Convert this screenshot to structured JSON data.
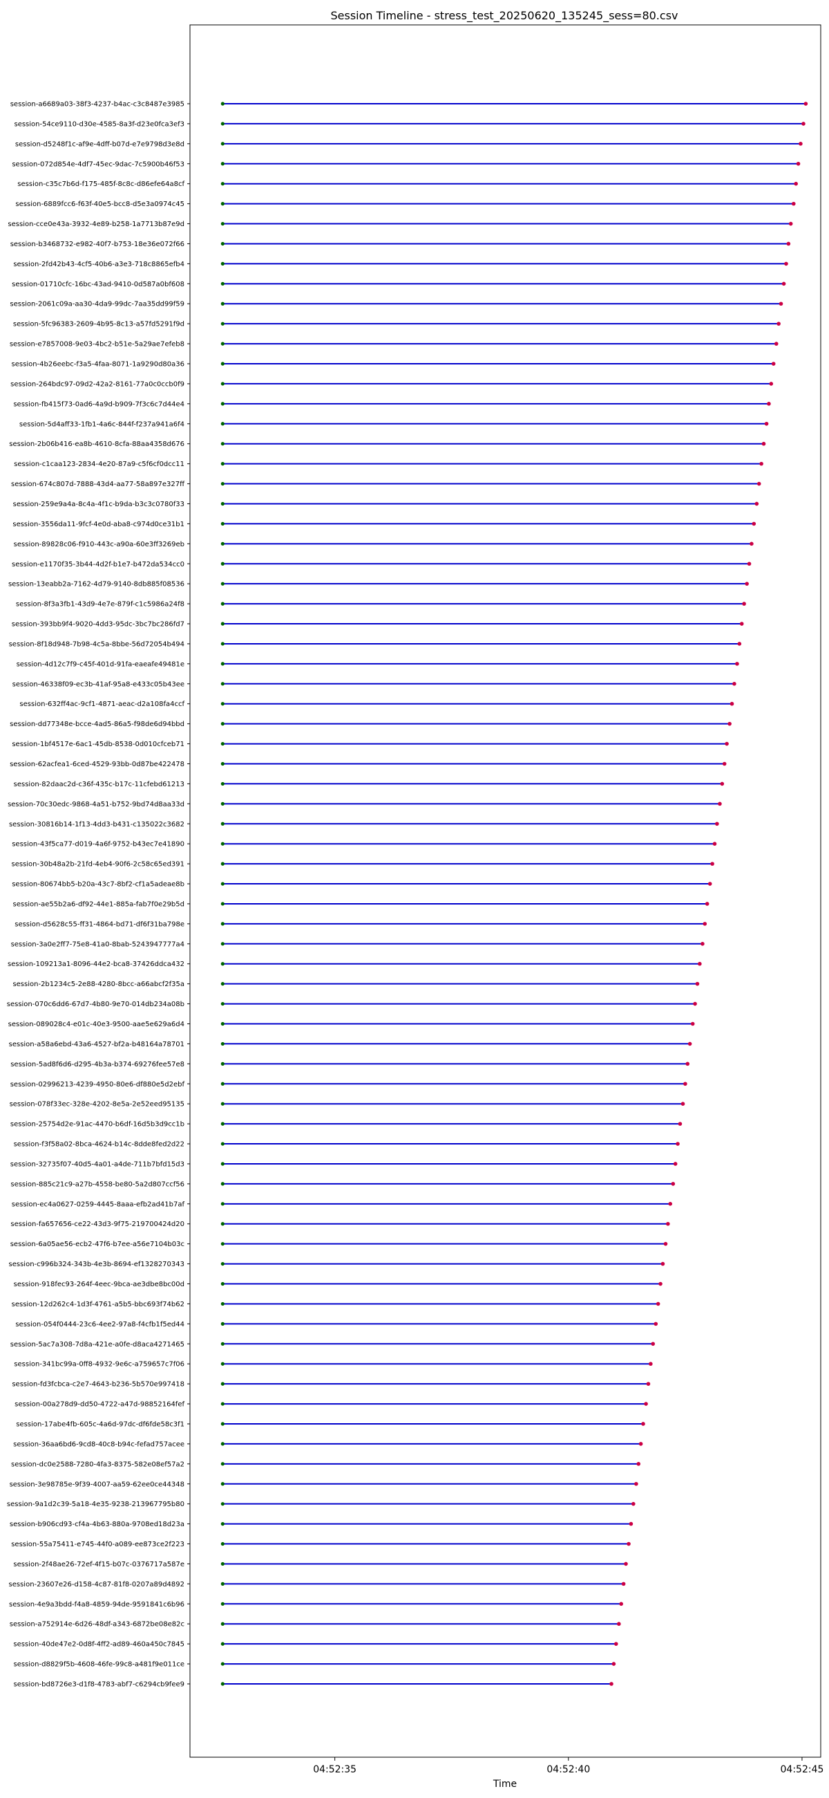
{
  "chart_data": {
    "type": "timeline",
    "title": "Session Timeline - stress_test_20250620_135245_sess=80.csv",
    "xlabel": "Time",
    "ylabel": "",
    "x_ticks": [
      "04:52:35",
      "04:52:40",
      "04:52:45"
    ],
    "xlim": [
      "04:52:31.9",
      "04:52:45.4"
    ],
    "grid": false,
    "colors": {
      "line": "#0000cc",
      "start": "#006400",
      "end": "#cc0044",
      "axis": "#000000"
    },
    "sessions": [
      {
        "label": "session-a6689a03-38f3-4237-b4ac-c3c8487e3985",
        "start": "04:52:32.6",
        "end": "04:52:45.08"
      },
      {
        "label": "session-54ce9110-d30e-4585-8a3f-d23e0fca3ef3",
        "start": "04:52:32.6",
        "end": "04:52:45.03"
      },
      {
        "label": "session-d5248f1c-af9e-4dff-b07d-e7e9798d3e8d",
        "start": "04:52:32.6",
        "end": "04:52:44.97"
      },
      {
        "label": "session-072d854e-4df7-45ec-9dac-7c5900b46f53",
        "start": "04:52:32.6",
        "end": "04:52:44.92"
      },
      {
        "label": "session-c35c7b6d-f175-485f-8c8c-d86efe64a8cf",
        "start": "04:52:32.6",
        "end": "04:52:44.87"
      },
      {
        "label": "session-6889fcc6-f63f-40e5-bcc8-d5e3a0974c45",
        "start": "04:52:32.6",
        "end": "04:52:44.82"
      },
      {
        "label": "session-cce0e43a-3932-4e89-b258-1a7713b87e9d",
        "start": "04:52:32.6",
        "end": "04:52:44.76"
      },
      {
        "label": "session-b3468732-e982-40f7-b753-18e36e072f66",
        "start": "04:52:32.6",
        "end": "04:52:44.71"
      },
      {
        "label": "session-2fd42b43-4cf5-40b6-a3e3-718c8865efb4",
        "start": "04:52:32.6",
        "end": "04:52:44.66"
      },
      {
        "label": "session-01710cfc-16bc-43ad-9410-0d587a0bf608",
        "start": "04:52:32.6",
        "end": "04:52:44.61"
      },
      {
        "label": "session-2061c09a-aa30-4da9-99dc-7aa35dd99f59",
        "start": "04:52:32.6",
        "end": "04:52:44.55"
      },
      {
        "label": "session-5fc96383-2609-4b95-8c13-a57fd5291f9d",
        "start": "04:52:32.6",
        "end": "04:52:44.5"
      },
      {
        "label": "session-e7857008-9e03-4bc2-b51e-5a29ae7efeb8",
        "start": "04:52:32.6",
        "end": "04:52:44.45"
      },
      {
        "label": "session-4b26eebc-f3a5-4faa-8071-1a9290d80a36",
        "start": "04:52:32.6",
        "end": "04:52:44.39"
      },
      {
        "label": "session-264bdc97-09d2-42a2-8161-77a0c0ccb0f9",
        "start": "04:52:32.6",
        "end": "04:52:44.34"
      },
      {
        "label": "session-fb415f73-0ad6-4a9d-b909-7f3c6c7d44e4",
        "start": "04:52:32.6",
        "end": "04:52:44.29"
      },
      {
        "label": "session-5d4aff33-1fb1-4a6c-844f-f237a941a6f4",
        "start": "04:52:32.6",
        "end": "04:52:44.24"
      },
      {
        "label": "session-2b06b416-ea8b-4610-8cfa-88aa4358d676",
        "start": "04:52:32.6",
        "end": "04:52:44.18"
      },
      {
        "label": "session-c1caa123-2834-4e20-87a9-c5f6cf0dcc11",
        "start": "04:52:32.6",
        "end": "04:52:44.13"
      },
      {
        "label": "session-674c807d-7888-43d4-aa77-58a897e327ff",
        "start": "04:52:32.6",
        "end": "04:52:44.08"
      },
      {
        "label": "session-259e9a4a-8c4a-4f1c-b9da-b3c3c0780f33",
        "start": "04:52:32.6",
        "end": "04:52:44.03"
      },
      {
        "label": "session-3556da11-9fcf-4e0d-aba8-c974d0ce31b1",
        "start": "04:52:32.6",
        "end": "04:52:43.97"
      },
      {
        "label": "session-89828c06-f910-443c-a90a-60e3ff3269eb",
        "start": "04:52:32.6",
        "end": "04:52:43.92"
      },
      {
        "label": "session-e1170f35-3b44-4d2f-b1e7-b472da534cc0",
        "start": "04:52:32.6",
        "end": "04:52:43.87"
      },
      {
        "label": "session-13eabb2a-7162-4d79-9140-8db885f08536",
        "start": "04:52:32.6",
        "end": "04:52:43.82"
      },
      {
        "label": "session-8f3a3fb1-43d9-4e7e-879f-c1c5986a24f8",
        "start": "04:52:32.6",
        "end": "04:52:43.76"
      },
      {
        "label": "session-393bb9f4-9020-4dd3-95dc-3bc7bc286fd7",
        "start": "04:52:32.6",
        "end": "04:52:43.71"
      },
      {
        "label": "session-8f18d948-7b98-4c5a-8bbe-56d72054b494",
        "start": "04:52:32.6",
        "end": "04:52:43.66"
      },
      {
        "label": "session-4d12c7f9-c45f-401d-91fa-eaeafe49481e",
        "start": "04:52:32.6",
        "end": "04:52:43.61"
      },
      {
        "label": "session-46338f09-ec3b-41af-95a8-e433c05b43ee",
        "start": "04:52:32.6",
        "end": "04:52:43.55"
      },
      {
        "label": "session-632ff4ac-9cf1-4871-aeac-d2a108fa4ccf",
        "start": "04:52:32.6",
        "end": "04:52:43.5"
      },
      {
        "label": "session-dd77348e-bcce-4ad5-86a5-f98de6d94bbd",
        "start": "04:52:32.6",
        "end": "04:52:43.45"
      },
      {
        "label": "session-1bf4517e-6ac1-45db-8538-0d010cfceb71",
        "start": "04:52:32.6",
        "end": "04:52:43.39"
      },
      {
        "label": "session-62acfea1-6ced-4529-93bb-0d87be422478",
        "start": "04:52:32.6",
        "end": "04:52:43.34"
      },
      {
        "label": "session-82daac2d-c36f-435c-b17c-11cfebd61213",
        "start": "04:52:32.6",
        "end": "04:52:43.29"
      },
      {
        "label": "session-70c30edc-9868-4a51-b752-9bd74d8aa33d",
        "start": "04:52:32.6",
        "end": "04:52:43.24"
      },
      {
        "label": "session-30816b14-1f13-4dd3-b431-c135022c3682",
        "start": "04:52:32.6",
        "end": "04:52:43.18"
      },
      {
        "label": "session-43f5ca77-d019-4a6f-9752-b43ec7e41890",
        "start": "04:52:32.6",
        "end": "04:52:43.13"
      },
      {
        "label": "session-30b48a2b-21fd-4eb4-90f6-2c58c65ed391",
        "start": "04:52:32.6",
        "end": "04:52:43.08"
      },
      {
        "label": "session-80674bb5-b20a-43c7-8bf2-cf1a5adeae8b",
        "start": "04:52:32.6",
        "end": "04:52:43.03"
      },
      {
        "label": "session-ae55b2a6-df92-44e1-885a-fab7f0e29b5d",
        "start": "04:52:32.6",
        "end": "04:52:42.97"
      },
      {
        "label": "session-d5628c55-ff31-4864-bd71-df6f31ba798e",
        "start": "04:52:32.6",
        "end": "04:52:42.92"
      },
      {
        "label": "session-3a0e2ff7-75e8-41a0-8bab-5243947777a4",
        "start": "04:52:32.6",
        "end": "04:52:42.87"
      },
      {
        "label": "session-109213a1-8096-44e2-bca8-37426ddca432",
        "start": "04:52:32.6",
        "end": "04:52:42.81"
      },
      {
        "label": "session-2b1234c5-2e88-4280-8bcc-a66abcf2f35a",
        "start": "04:52:32.6",
        "end": "04:52:42.76"
      },
      {
        "label": "session-070c6dd6-67d7-4b80-9e70-014db234a08b",
        "start": "04:52:32.6",
        "end": "04:52:42.71"
      },
      {
        "label": "session-089028c4-e01c-40e3-9500-aae5e629a6d4",
        "start": "04:52:32.6",
        "end": "04:52:42.66"
      },
      {
        "label": "session-a58a6ebd-43a6-4527-bf2a-b48164a78701",
        "start": "04:52:32.6",
        "end": "04:52:42.6"
      },
      {
        "label": "session-5ad8f6d6-d295-4b3a-b374-69276fee57e8",
        "start": "04:52:32.6",
        "end": "04:52:42.55"
      },
      {
        "label": "session-02996213-4239-4950-80e6-df880e5d2ebf",
        "start": "04:52:32.6",
        "end": "04:52:42.5"
      },
      {
        "label": "session-078f33ec-328e-4202-8e5a-2e52eed95135",
        "start": "04:52:32.6",
        "end": "04:52:42.45"
      },
      {
        "label": "session-25754d2e-91ac-4470-b6df-16d5b3d9cc1b",
        "start": "04:52:32.6",
        "end": "04:52:42.39"
      },
      {
        "label": "session-f3f58a02-8bca-4624-b14c-8dde8fed2d22",
        "start": "04:52:32.6",
        "end": "04:52:42.34"
      },
      {
        "label": "session-32735f07-40d5-4a01-a4de-711b7bfd15d3",
        "start": "04:52:32.6",
        "end": "04:52:42.29"
      },
      {
        "label": "session-885c21c9-a27b-4558-be80-5a2d807ccf56",
        "start": "04:52:32.6",
        "end": "04:52:42.24"
      },
      {
        "label": "session-ec4a0627-0259-4445-8aaa-efb2ad41b7af",
        "start": "04:52:32.6",
        "end": "04:52:42.18"
      },
      {
        "label": "session-fa657656-ce22-43d3-9f75-219700424d20",
        "start": "04:52:32.6",
        "end": "04:52:42.13"
      },
      {
        "label": "session-6a05ae56-ecb2-47f6-b7ee-a56e7104b03c",
        "start": "04:52:32.6",
        "end": "04:52:42.08"
      },
      {
        "label": "session-c996b324-343b-4e3b-8694-ef1328270343",
        "start": "04:52:32.6",
        "end": "04:52:42.02"
      },
      {
        "label": "session-918fec93-264f-4eec-9bca-ae3dbe8bc00d",
        "start": "04:52:32.6",
        "end": "04:52:41.97"
      },
      {
        "label": "session-12d262c4-1d3f-4761-a5b5-bbc693f74b62",
        "start": "04:52:32.6",
        "end": "04:52:41.92"
      },
      {
        "label": "session-054f0444-23c6-4ee2-97a8-f4cfb1f5ed44",
        "start": "04:52:32.6",
        "end": "04:52:41.87"
      },
      {
        "label": "session-5ac7a308-7d8a-421e-a0fe-d8aca4271465",
        "start": "04:52:32.6",
        "end": "04:52:41.81"
      },
      {
        "label": "session-341bc99a-0ff8-4932-9e6c-a759657c7f06",
        "start": "04:52:32.6",
        "end": "04:52:41.76"
      },
      {
        "label": "session-fd3fcbca-c2e7-4643-b236-5b570e997418",
        "start": "04:52:32.6",
        "end": "04:52:41.71"
      },
      {
        "label": "session-00a278d9-dd50-4722-a47d-98852164fef",
        "start": "04:52:32.6",
        "end": "04:52:41.66"
      },
      {
        "label": "session-17abe4fb-605c-4a6d-97dc-df6fde58c3f1",
        "start": "04:52:32.6",
        "end": "04:52:41.6"
      },
      {
        "label": "session-36aa6bd6-9cd8-40c8-b94c-fefad757acee",
        "start": "04:52:32.6",
        "end": "04:52:41.55"
      },
      {
        "label": "session-dc0e2588-7280-4fa3-8375-582e08ef57a2",
        "start": "04:52:32.6",
        "end": "04:52:41.5"
      },
      {
        "label": "session-3e98785e-9f39-4007-aa59-62ee0ce44348",
        "start": "04:52:32.6",
        "end": "04:52:41.45"
      },
      {
        "label": "session-9a1d2c39-5a18-4e35-9238-213967795b80",
        "start": "04:52:32.6",
        "end": "04:52:41.39"
      },
      {
        "label": "session-b906cd93-cf4a-4b63-880a-9708ed18d23a",
        "start": "04:52:32.6",
        "end": "04:52:41.34"
      },
      {
        "label": "session-55a75411-e745-44f0-a089-ee873ce2f223",
        "start": "04:52:32.6",
        "end": "04:52:41.29"
      },
      {
        "label": "session-2f48ae26-72ef-4f15-b07c-0376717a587e",
        "start": "04:52:32.6",
        "end": "04:52:41.23"
      },
      {
        "label": "session-23607e26-d158-4c87-81f8-0207a89d4892",
        "start": "04:52:32.6",
        "end": "04:52:41.18"
      },
      {
        "label": "session-4e9a3bdd-f4a8-4859-94de-9591841c6b96",
        "start": "04:52:32.6",
        "end": "04:52:41.13"
      },
      {
        "label": "session-a752914e-6d26-48df-a343-6872be08e82c",
        "start": "04:52:32.6",
        "end": "04:52:41.08"
      },
      {
        "label": "session-40de47e2-0d8f-4ff2-ad89-460a450c7845",
        "start": "04:52:32.6",
        "end": "04:52:41.02"
      },
      {
        "label": "session-d8829f5b-4608-46fe-99c8-a481f9e011ce",
        "start": "04:52:32.6",
        "end": "04:52:40.97"
      },
      {
        "label": "session-bd8726e3-d1f8-4783-abf7-c6294cb9fee9",
        "start": "04:52:32.6",
        "end": "04:52:40.92"
      }
    ]
  }
}
